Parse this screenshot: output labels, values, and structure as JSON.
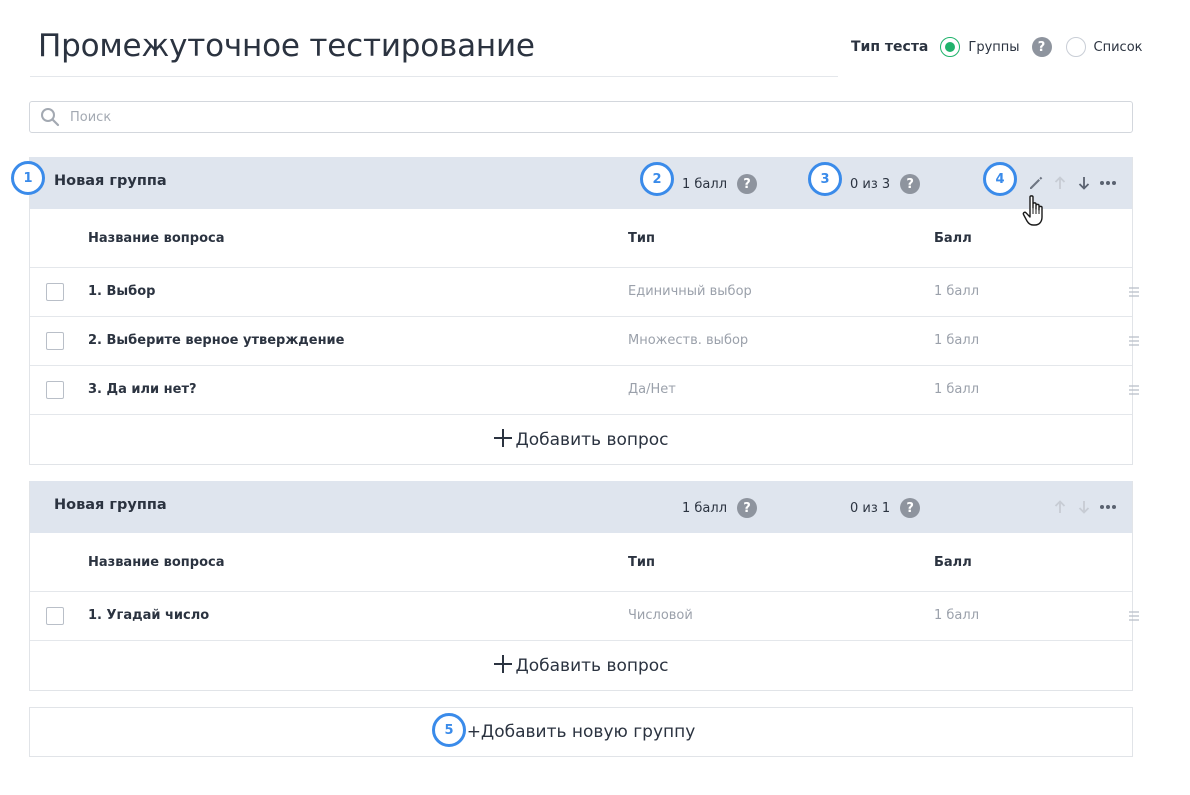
{
  "page": {
    "title": "Промежуточное тестирование"
  },
  "test_type": {
    "label": "Тип теста",
    "options": [
      {
        "label": "Группы",
        "selected": true
      },
      {
        "label": "Список",
        "selected": false
      }
    ],
    "help": "?"
  },
  "search": {
    "placeholder": "Поиск"
  },
  "columns": {
    "name": "Название вопроса",
    "type": "Тип",
    "score": "Балл"
  },
  "groups": [
    {
      "name": "Новая группа",
      "points": "1 балл",
      "count": "0 из 3",
      "questions": [
        {
          "name": "1. Выбор",
          "type": "Единичный выбор",
          "score": "1 балл"
        },
        {
          "name": "2. Выберите верное утверждение",
          "type": "Множеств. выбор",
          "score": "1 балл"
        },
        {
          "name": "3. Да или нет?",
          "type": "Да/Нет",
          "score": "1 балл"
        }
      ],
      "add_question": "Добавить вопрос"
    },
    {
      "name": "Новая группа",
      "points": "1 балл",
      "count": "0 из 1",
      "questions": [
        {
          "name": "1. Угадай число",
          "type": "Числовой",
          "score": "1 балл"
        }
      ],
      "add_question": "Добавить вопрос"
    }
  ],
  "add_group": "+Добавить новую группу",
  "markers": [
    "1",
    "2",
    "3",
    "4",
    "5"
  ],
  "colors": {
    "accent": "#3a8bea",
    "radio_selected": "#1fb36b",
    "group_header": "#dfe5ee"
  },
  "icons": [
    "search-icon",
    "help-icon",
    "pencil-icon",
    "arrow-up-icon",
    "arrow-down-icon",
    "more-icon",
    "drag-handle-icon",
    "plus-icon",
    "hand-cursor-icon"
  ]
}
